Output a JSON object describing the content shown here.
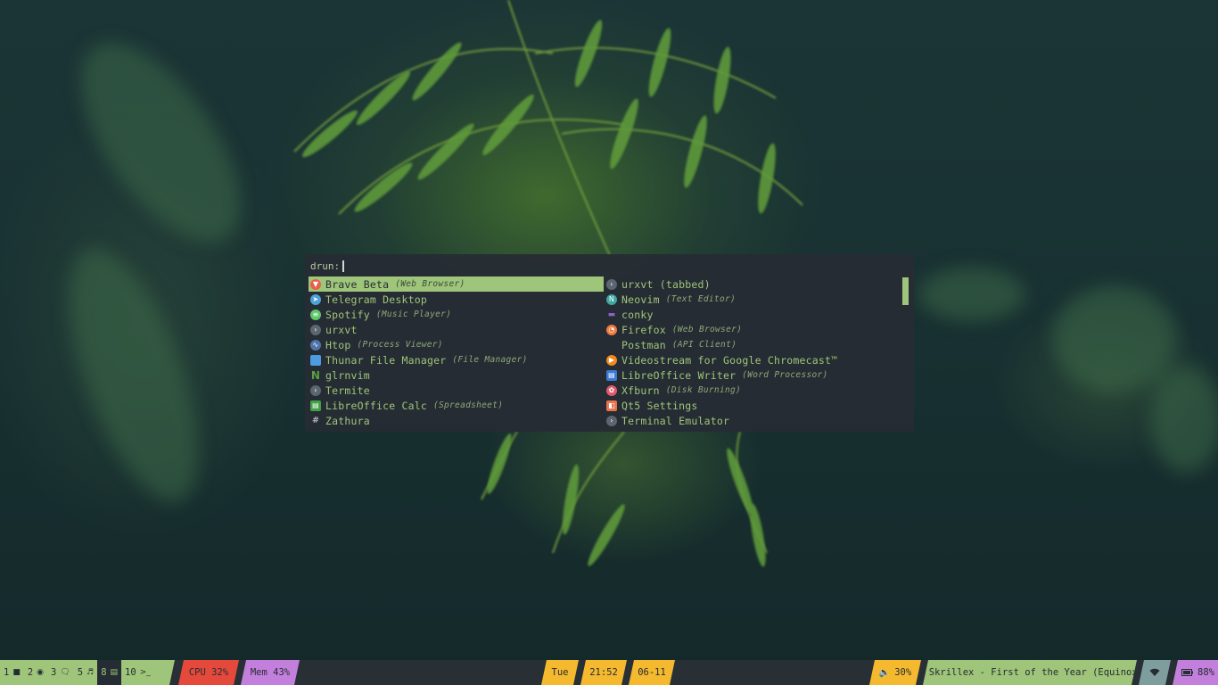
{
  "launcher": {
    "prompt": "drun:",
    "query": "",
    "left_column": [
      {
        "name": "Brave Beta",
        "generic": "(Web Browser)",
        "icon": "brave-icon",
        "color": "#e8604c",
        "selected": true
      },
      {
        "name": "Telegram Desktop",
        "generic": "",
        "icon": "telegram-icon",
        "color": "#4ba3d9"
      },
      {
        "name": "Spotify",
        "generic": "(Music Player)",
        "icon": "spotify-icon",
        "color": "#5fc76a"
      },
      {
        "name": "urxvt",
        "generic": "",
        "icon": "terminal-icon",
        "color": "#5c6670"
      },
      {
        "name": "Htop",
        "generic": "(Process Viewer)",
        "icon": "htop-icon",
        "color": "#4f74a8"
      },
      {
        "name": "Thunar File Manager",
        "generic": "(File Manager)",
        "icon": "folder-icon",
        "color": "#4d9be0"
      },
      {
        "name": "glrnvim",
        "generic": "",
        "icon": "neovim-logo-icon",
        "color": "#57a143"
      },
      {
        "name": "Termite",
        "generic": "",
        "icon": "terminal-icon",
        "color": "#5c6670"
      },
      {
        "name": "LibreOffice Calc",
        "generic": "(Spreadsheet)",
        "icon": "libreoffice-calc-icon",
        "color": "#43a047"
      },
      {
        "name": "Zathura",
        "generic": "",
        "icon": "hash-icon",
        "color": "#262c33"
      }
    ],
    "right_column": [
      {
        "name": "urxvt (tabbed)",
        "generic": "",
        "icon": "terminal-icon",
        "color": "#5c6670"
      },
      {
        "name": "Neovim",
        "generic": "(Text Editor)",
        "icon": "neovim-icon",
        "color": "#3fa7a0"
      },
      {
        "name": "conky",
        "generic": "",
        "icon": "chat-icon",
        "color": "#8a63c9"
      },
      {
        "name": "Firefox",
        "generic": "(Web Browser)",
        "icon": "firefox-icon",
        "color": "#f07b3c"
      },
      {
        "name": "Postman",
        "generic": "(API Client)",
        "icon": "",
        "color": ""
      },
      {
        "name": "Videostream for Google Chromecast™",
        "generic": "",
        "icon": "videostream-icon",
        "color": "#f08a1c"
      },
      {
        "name": "LibreOffice Writer",
        "generic": "(Word Processor)",
        "icon": "libreoffice-writer-icon",
        "color": "#3b7bd6"
      },
      {
        "name": "Xfburn",
        "generic": "(Disk Burning)",
        "icon": "xfburn-icon",
        "color": "#e05a6a"
      },
      {
        "name": "Qt5 Settings",
        "generic": "",
        "icon": "qt-settings-icon",
        "color": "#e8734c"
      },
      {
        "name": "Terminal Emulator",
        "generic": "",
        "icon": "terminal-icon",
        "color": "#5c6670"
      }
    ]
  },
  "bar": {
    "workspaces": [
      {
        "num": "1",
        "icon": "■",
        "icon_name": "square-icon",
        "active": false
      },
      {
        "num": "2",
        "icon": "◉",
        "icon_name": "chrome-icon",
        "active": false
      },
      {
        "num": "3",
        "icon": "🗨",
        "icon_name": "chat-icon",
        "active": false
      },
      {
        "num": "5",
        "icon": "♬",
        "icon_name": "music-icon",
        "active": false
      },
      {
        "num": "8",
        "icon": "▤",
        "icon_name": "book-icon",
        "active": true
      },
      {
        "num": "10",
        "icon": ">_",
        "icon_name": "terminal-icon",
        "active": false
      }
    ],
    "cpu": "CPU 32%",
    "mem": "Mem 43%",
    "day": "Tue",
    "time": "21:52",
    "date": "06-11",
    "volume": "30%",
    "spotify_track": "Skrillex - First of the Year (Equinox)",
    "battery": "88%"
  },
  "colors": {
    "accent_green": "#9fc57a",
    "launcher_bg": "#262c33",
    "cpu_red": "#e5493b",
    "mem_purple": "#c27fdb",
    "clock_yellow": "#f4b92e",
    "wifi_gray": "#7e9e9e"
  }
}
